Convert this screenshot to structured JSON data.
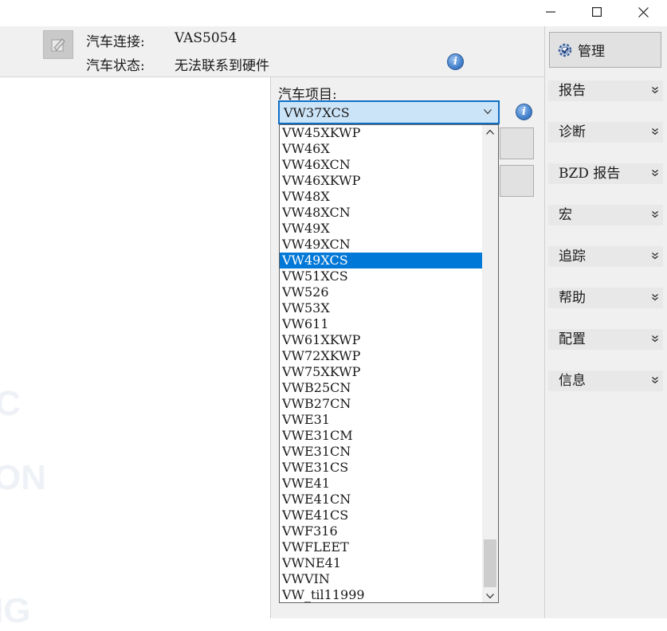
{
  "header": {
    "connection_label": "汽车连接:",
    "connection_value": "VAS5054",
    "status_label": "汽车状态:",
    "status_value": "无法联系到硬件",
    "info_glyph": "i"
  },
  "project": {
    "label": "汽车项目:",
    "selected": "VW37XCS",
    "info_glyph": "i",
    "options": [
      "VW45XKWP",
      "VW46X",
      "VW46XCN",
      "VW46XKWP",
      "VW48X",
      "VW48XCN",
      "VW49X",
      "VW49XCN",
      "VW49XCS",
      "VW51XCS",
      "VW526",
      "VW53X",
      "VW611",
      "VW61XKWP",
      "VW72XKWP",
      "VW75XKWP",
      "VWB25CN",
      "VWB27CN",
      "VWE31",
      "VWE31CM",
      "VWE31CN",
      "VWE31CS",
      "VWE41",
      "VWE41CN",
      "VWE41CS",
      "VWF316",
      "VWFLEET",
      "VWNE41",
      "VWVIN",
      "VW_til11999"
    ],
    "highlighted": "VW49XCS"
  },
  "sidebar": {
    "admin_label": "管理",
    "items": [
      {
        "label": "报告"
      },
      {
        "label": "诊断"
      },
      {
        "label": "BZD 报告"
      },
      {
        "label": "宏"
      },
      {
        "label": "追踪"
      },
      {
        "label": "帮助"
      },
      {
        "label": "配置"
      },
      {
        "label": "信息"
      }
    ]
  },
  "background_ghost_text": [
    "C",
    "ON",
    "IG"
  ],
  "colors": {
    "accent": "#0078d7",
    "combo_border": "#0f6fc6",
    "combo_fill": "#cce4f7",
    "panel": "#f0f0f0"
  }
}
